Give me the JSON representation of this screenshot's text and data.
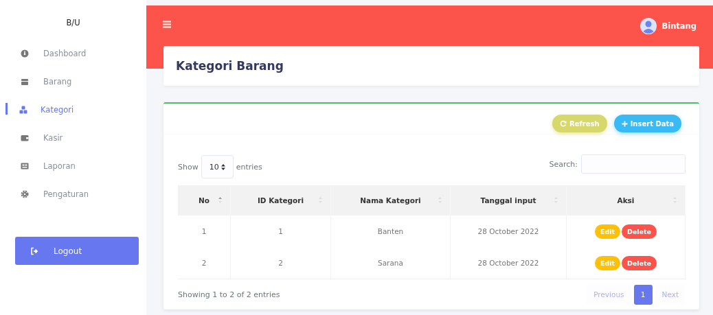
{
  "sidebar": {
    "brand": "B/U",
    "items": [
      {
        "label": "Dashboard",
        "selected": false
      },
      {
        "label": "Barang",
        "selected": false
      },
      {
        "label": "Kategori",
        "selected": true
      },
      {
        "label": "Kasir",
        "selected": false
      },
      {
        "label": "Laporan",
        "selected": false
      },
      {
        "label": "Pengaturan",
        "selected": false
      }
    ],
    "logout": "Logout"
  },
  "header": {
    "user": "Bintang"
  },
  "page_title": "Kategori Barang",
  "toolbar": {
    "refresh": "Refresh",
    "insert": "Insert Data"
  },
  "length": {
    "before": "Show",
    "value": "10",
    "after": "entries"
  },
  "search": {
    "label": "Search:"
  },
  "table": {
    "columns": [
      {
        "label": "No",
        "sorted": true
      },
      {
        "label": "ID Kategori",
        "sorted": false
      },
      {
        "label": "Nama Kategori",
        "sorted": false
      },
      {
        "label": "Tanggal input",
        "sorted": false
      },
      {
        "label": "Aksi",
        "sorted": false
      }
    ],
    "rows": [
      {
        "cells": [
          "1",
          "1",
          "Banten",
          "28 October 2022"
        ],
        "edit": "Edit",
        "delete": "Delete"
      },
      {
        "cells": [
          "2",
          "2",
          "Sarana",
          "28 October 2022"
        ],
        "edit": "Edit",
        "delete": "Delete"
      }
    ]
  },
  "info": "Showing 1 to 2 of 2 entries",
  "pagination": {
    "previous": {
      "label": "Previous",
      "disabled": true
    },
    "pages": [
      {
        "label": "1",
        "selected": true
      }
    ],
    "next": {
      "label": "Next",
      "disabled": true
    }
  }
}
